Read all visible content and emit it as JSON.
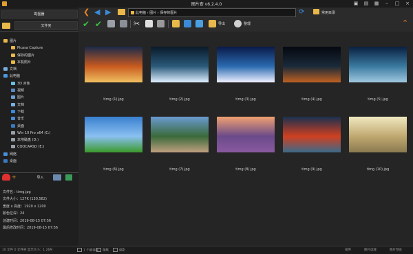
{
  "window": {
    "title": "图片查 v6.2.4.0"
  },
  "sidebar": {
    "top_button": "勘图器",
    "folder_button": "文件夹",
    "tree": [
      {
        "label": "图片",
        "depth": 1,
        "icon": "folder-icon"
      },
      {
        "label": "Picasa Capture",
        "depth": 2,
        "icon": "folder-icon"
      },
      {
        "label": "保存的图片",
        "depth": 2,
        "icon": "folder-icon"
      },
      {
        "label": "本机照片",
        "depth": 2,
        "icon": "folder-icon"
      },
      {
        "label": "文档",
        "depth": 1,
        "icon": "document-icon"
      },
      {
        "label": "此电脑",
        "depth": 1,
        "icon": "computer-icon"
      },
      {
        "label": "3D 对象",
        "depth": 2,
        "icon": "cube-icon"
      },
      {
        "label": "视频",
        "depth": 2,
        "icon": "video-icon"
      },
      {
        "label": "图片",
        "depth": 2,
        "icon": "image-icon"
      },
      {
        "label": "文档",
        "depth": 2,
        "icon": "document-icon"
      },
      {
        "label": "下载",
        "depth": 2,
        "icon": "download-icon"
      },
      {
        "label": "音乐",
        "depth": 2,
        "icon": "music-icon"
      },
      {
        "label": "桌面",
        "depth": 2,
        "icon": "desktop-icon"
      },
      {
        "label": "Win 10 Pro x64 (C:)",
        "depth": 2,
        "icon": "drive-icon"
      },
      {
        "label": "本地磁盘 (D:)",
        "depth": 2,
        "icon": "drive-icon"
      },
      {
        "label": "COOCAASD (E:)",
        "depth": 2,
        "icon": "drive-icon"
      },
      {
        "label": "网络",
        "depth": 1,
        "icon": "network-icon"
      },
      {
        "label": "桌面",
        "depth": 1,
        "icon": "desktop-icon"
      }
    ],
    "import_label": "导入",
    "info": [
      "文件名：timg.jpg",
      "文件大小：127K (130,582)",
      "宽度 x 高度：1920 x 1200",
      "颜色位深：24",
      "创建时间：2019-08-15 07:56",
      "最后修改时间：2019-08-15 07:56"
    ]
  },
  "toolbar": {
    "breadcrumb": [
      "此电脑",
      "图片",
      "保存的图片"
    ],
    "fav_label": "常用目录",
    "export_label": "导出",
    "wallpaper_label": "整理"
  },
  "thumbnails": [
    {
      "caption": "timg (1).jpg",
      "colors": [
        "#1a2a4a",
        "#c85a20",
        "#f0c060"
      ]
    },
    {
      "caption": "timg (2).jpg",
      "colors": [
        "#0a1a2a",
        "#2a5a7a",
        "#e0f0ff"
      ]
    },
    {
      "caption": "timg (3).jpg",
      "colors": [
        "#0a1a4a",
        "#2a6ab0",
        "#f0f0ff"
      ]
    },
    {
      "caption": "timg (4).jpg",
      "colors": [
        "#05080f",
        "#1a2a3a",
        "#c06020"
      ]
    },
    {
      "caption": "timg (5).jpg",
      "colors": [
        "#0a2040",
        "#3a7aa0",
        "#a0c8e0"
      ]
    },
    {
      "caption": "timg (6).jpg",
      "colors": [
        "#3a80d0",
        "#8ac0f0",
        "#3a9a2a"
      ]
    },
    {
      "caption": "timg (7).jpg",
      "colors": [
        "#6a9ad0",
        "#3a6a3a",
        "#c0a080"
      ]
    },
    {
      "caption": "timg (8).jpg",
      "colors": [
        "#f0a070",
        "#6a4a8a",
        "#8a5aa0"
      ]
    },
    {
      "caption": "timg (9).jpg",
      "colors": [
        "#1a3050",
        "#d04020",
        "#3a6a8a"
      ]
    },
    {
      "caption": "timg (10).jpg",
      "colors": [
        "#f0e8c0",
        "#c0a870",
        "#8a7a50"
      ]
    }
  ],
  "statusbar": {
    "left": "10 文件   0 文件夹   显示大小：1.26M",
    "opt1": "1 个被选择",
    "opt2": "相框",
    "opt3": "缩影",
    "right1": "排序",
    "right2": "图片选择",
    "right3": "图片预览"
  },
  "colors": {
    "accent": "#f08020",
    "nav_blue": "#3a8ad8",
    "folder": "#e8b84a"
  }
}
